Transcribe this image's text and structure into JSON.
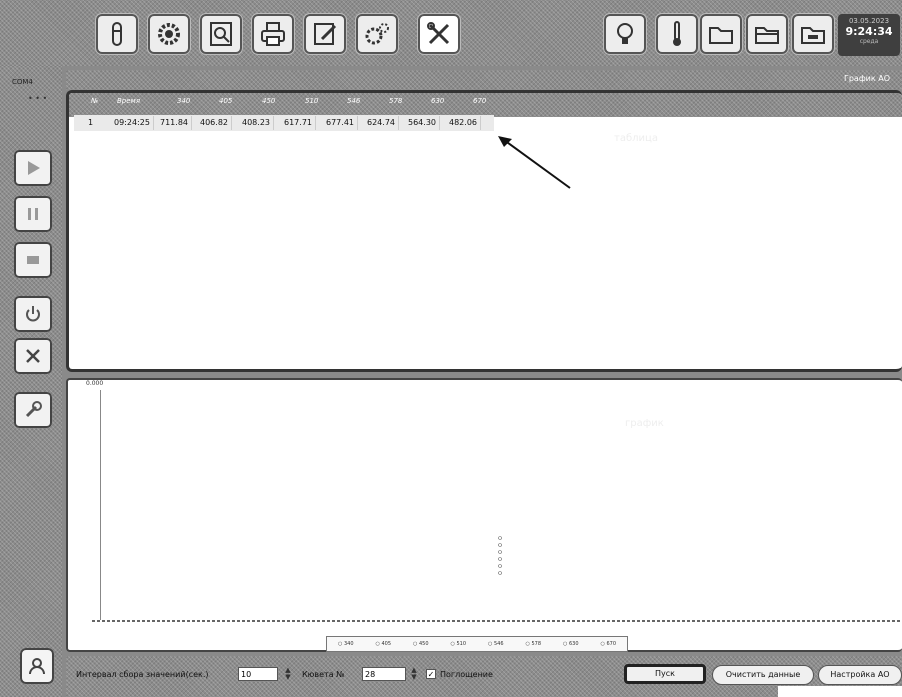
{
  "toolbar": {
    "icons": [
      "test-tube",
      "gear",
      "search-document",
      "printer",
      "edit",
      "settings-gears",
      "tools",
      "lamp",
      "thermometer",
      "folder",
      "folder-open",
      "folder-closed"
    ]
  },
  "clock": {
    "date": "03.05.2023",
    "time": "9:24:34",
    "day": "среда"
  },
  "sidebar": {
    "com_label": "COM4",
    "com_indicator": "• • •",
    "buttons": [
      "play",
      "pause",
      "stop",
      "power",
      "close",
      "wrench"
    ]
  },
  "header": {
    "graph_label": "График АО"
  },
  "table": {
    "columns": [
      "№",
      "Время",
      "340",
      "405",
      "450",
      "510",
      "546",
      "578",
      "630",
      "670"
    ],
    "rows": [
      [
        "1",
        "09:24:25",
        "711.84",
        "406.82",
        "408.23",
        "617.71",
        "677.41",
        "624.74",
        "564.30",
        "482.06"
      ]
    ],
    "watermark": "таблица"
  },
  "chart_data": {
    "type": "scatter",
    "y_top_label": "0.000",
    "watermark": "график",
    "legend": [
      "340",
      "405",
      "450",
      "510",
      "546",
      "578",
      "630",
      "670"
    ]
  },
  "bottom": {
    "interval_label": "Интервал сбора значений(сек.)",
    "interval_value": "10",
    "cuvette_label": "Кювета №",
    "cuvette_value": "28",
    "absorption_label": "Поглощение",
    "absorption_checked": true,
    "start_button": "Пуск",
    "clear_button": "Очистить данные",
    "settings_button": "Настройка АО"
  },
  "colors": {
    "dither": "#8c8c8c",
    "panel_border": "#333333"
  }
}
